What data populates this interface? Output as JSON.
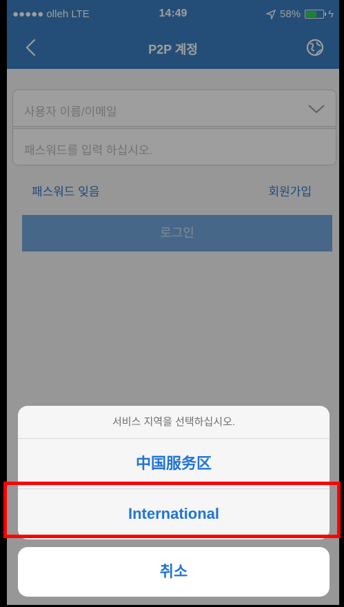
{
  "status_bar": {
    "carrier": "●●●●● olleh  LTE",
    "time": "14:49",
    "battery": "58%",
    "battery_level": 0.58
  },
  "nav": {
    "title": "P2P 계정"
  },
  "form": {
    "username_placeholder": "사용자 이름/이메일",
    "password_placeholder": "패스워드를 입력 하십시오.",
    "forgot_password": "패스워드 잊음",
    "signup": "회원가입",
    "login_button": "로그인"
  },
  "action_sheet": {
    "title": "서비스 지역을 선택하십시오.",
    "options": [
      "中国服务区",
      "International"
    ],
    "cancel": "취소"
  },
  "colors": {
    "nav_bg": "#3b7fc1",
    "action_text": "#1f74d6",
    "highlight": "#ff0000"
  }
}
